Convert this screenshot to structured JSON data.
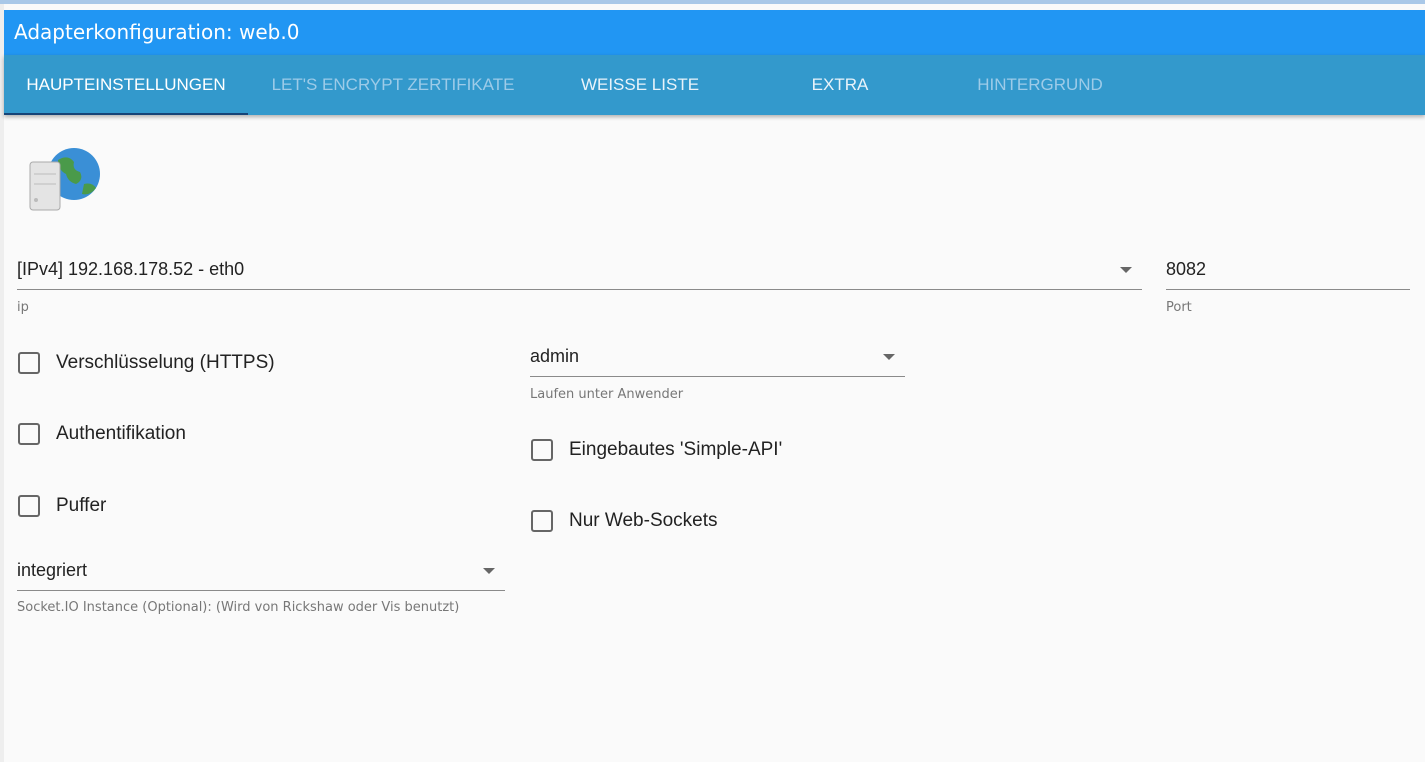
{
  "title": "Adapterkonfiguration: web.0",
  "tabs": [
    {
      "label": "HAUPTEINSTELLUNGEN"
    },
    {
      "label": "LET'S ENCRYPT ZERTIFIKATE"
    },
    {
      "label": "WEISSE LISTE"
    },
    {
      "label": "EXTRA"
    },
    {
      "label": "HINTERGRUND"
    }
  ],
  "ip": {
    "value": "[IPv4] 192.168.178.52 - eth0",
    "label": "ip"
  },
  "port": {
    "value": "8082",
    "label": "Port"
  },
  "run_as": {
    "value": "admin",
    "label": "Laufen unter Anwender"
  },
  "checkboxes": {
    "https": "Verschlüsselung (HTTPS)",
    "auth": "Authentifikation",
    "cache": "Puffer",
    "simple_api": "Eingebautes 'Simple-API'",
    "web_sockets": "Nur Web-Sockets"
  },
  "socketio": {
    "value": "integriert",
    "label": "Socket.IO Instance (Optional): (Wird von Rickshaw oder Vis benutzt)"
  }
}
